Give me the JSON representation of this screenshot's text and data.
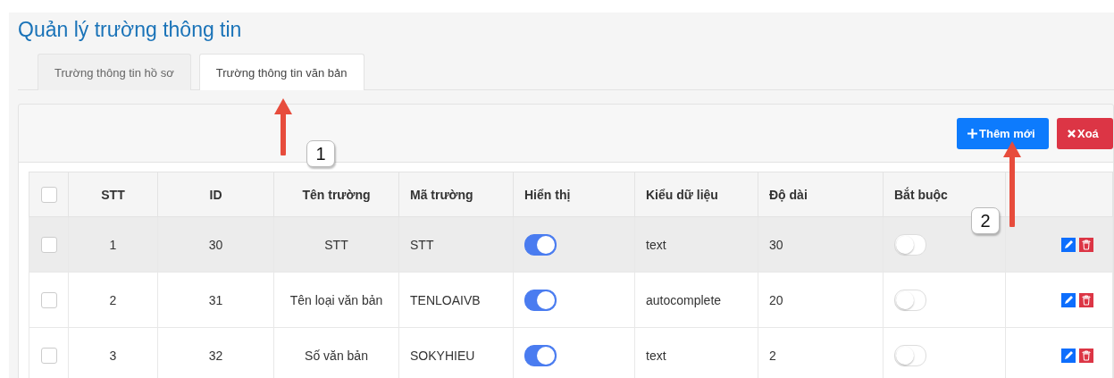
{
  "title": "Quản lý trường thông tin",
  "tabs": [
    {
      "label": "Trường thông tin hồ sơ",
      "selected": false
    },
    {
      "label": "Trường thông tin văn bản",
      "selected": true
    }
  ],
  "toolbar": {
    "add_button": "Thêm mới",
    "delete_button": "Xoá"
  },
  "table": {
    "select_all_checked": false,
    "columns": [
      "STT",
      "ID",
      "Tên trường",
      "Mã trường",
      "Hiển thị",
      "Kiểu dữ liệu",
      "Độ dài",
      "Bắt buộc"
    ],
    "rows": [
      {
        "checked": false,
        "highlighted": true,
        "stt": "1",
        "id": "30",
        "name": "STT",
        "code": "STT",
        "visible": true,
        "type": "text",
        "length": "30",
        "required": false
      },
      {
        "checked": false,
        "highlighted": false,
        "stt": "2",
        "id": "31",
        "name": "Tên loại văn bản",
        "code": "TENLOAIVB",
        "visible": true,
        "type": "autocomplete",
        "length": "20",
        "required": false
      },
      {
        "checked": false,
        "highlighted": false,
        "stt": "3",
        "id": "32",
        "name": "Số văn bản",
        "code": "SOKYHIEU",
        "visible": true,
        "type": "text",
        "length": "2",
        "required": false
      }
    ]
  },
  "annotations": [
    {
      "label": "1"
    },
    {
      "label": "2"
    }
  ]
}
